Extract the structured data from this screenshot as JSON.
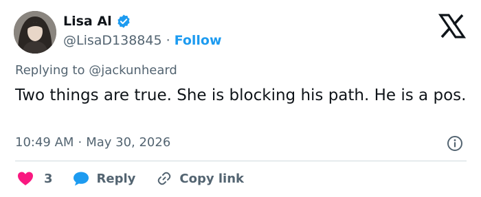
{
  "author": {
    "name": "Lisa Al",
    "handle": "@LisaD138845",
    "separator": "·",
    "follow_label": "Follow",
    "verified_color": "#1d9bf0"
  },
  "tweet": {
    "replying_prefix": "Replying to",
    "replying_handle": "@jackunheard",
    "text": "Two things are true. She is blocking his path. He is a pos.",
    "time": "10:49 AM",
    "date_separator": "·",
    "date": "May 30, 2026"
  },
  "actions": {
    "like_count": "3",
    "reply_label": "Reply",
    "copy_label": "Copy link",
    "like_color": "#f91880",
    "reply_color": "#1d9bf0"
  },
  "icons": {
    "brand": "x-logo-icon",
    "info": "info-icon",
    "like": "heart-icon",
    "reply": "speech-bubble-icon",
    "copy": "link-icon"
  }
}
